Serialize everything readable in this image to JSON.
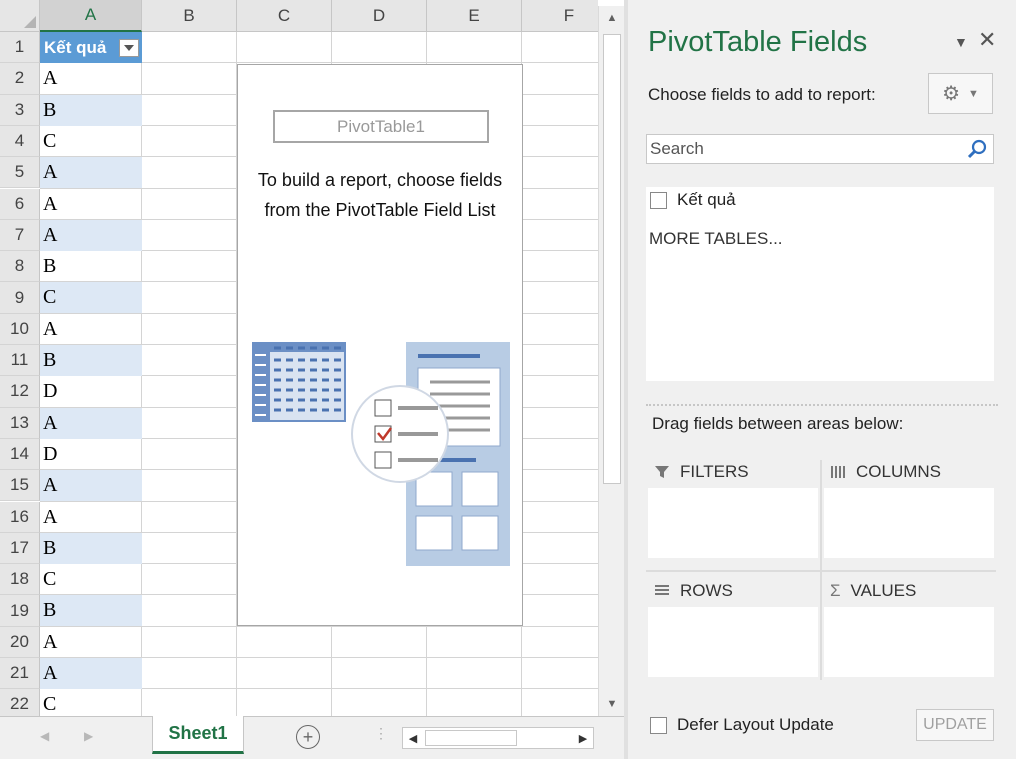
{
  "sheet": {
    "columns": [
      "A",
      "B",
      "C",
      "D",
      "E",
      "F"
    ],
    "header_cell": "Kết quả",
    "rows": [
      {
        "num": "1"
      },
      {
        "num": "2",
        "value": "A"
      },
      {
        "num": "3",
        "value": "B"
      },
      {
        "num": "4",
        "value": "C"
      },
      {
        "num": "5",
        "value": "A"
      },
      {
        "num": "6",
        "value": "A"
      },
      {
        "num": "7",
        "value": "A"
      },
      {
        "num": "8",
        "value": "B"
      },
      {
        "num": "9",
        "value": "C"
      },
      {
        "num": "10",
        "value": "A"
      },
      {
        "num": "11",
        "value": "B"
      },
      {
        "num": "12",
        "value": "D"
      },
      {
        "num": "13",
        "value": "A"
      },
      {
        "num": "14",
        "value": "D"
      },
      {
        "num": "15",
        "value": "A"
      },
      {
        "num": "16",
        "value": "A"
      },
      {
        "num": "17",
        "value": "B"
      },
      {
        "num": "18",
        "value": "C"
      },
      {
        "num": "19",
        "value": "B"
      },
      {
        "num": "20",
        "value": "A"
      },
      {
        "num": "21",
        "value": "A"
      },
      {
        "num": "22",
        "value": "C"
      }
    ],
    "accent_color": "#217346",
    "header_fill": "#5b9bd5",
    "band_fill": "#dde8f5"
  },
  "pivot": {
    "name": "PivotTable1",
    "instruction": "To build a report, choose fields from the PivotTable Field List"
  },
  "tabs": {
    "sheet_name": "Sheet1",
    "add_icon": "plus-circle-icon"
  },
  "panel": {
    "title": "PivotTable Fields",
    "choose_label": "Choose fields to add to report:",
    "search_placeholder": "Search",
    "fields": [
      "Kết quả"
    ],
    "more_tables": "MORE TABLES...",
    "drag_label": "Drag fields between areas below:",
    "areas": {
      "filters": "FILTERS",
      "columns": "COLUMNS",
      "rows": "ROWS",
      "values": "VALUES"
    },
    "defer_label": "Defer Layout Update",
    "update_label": "UPDATE"
  }
}
